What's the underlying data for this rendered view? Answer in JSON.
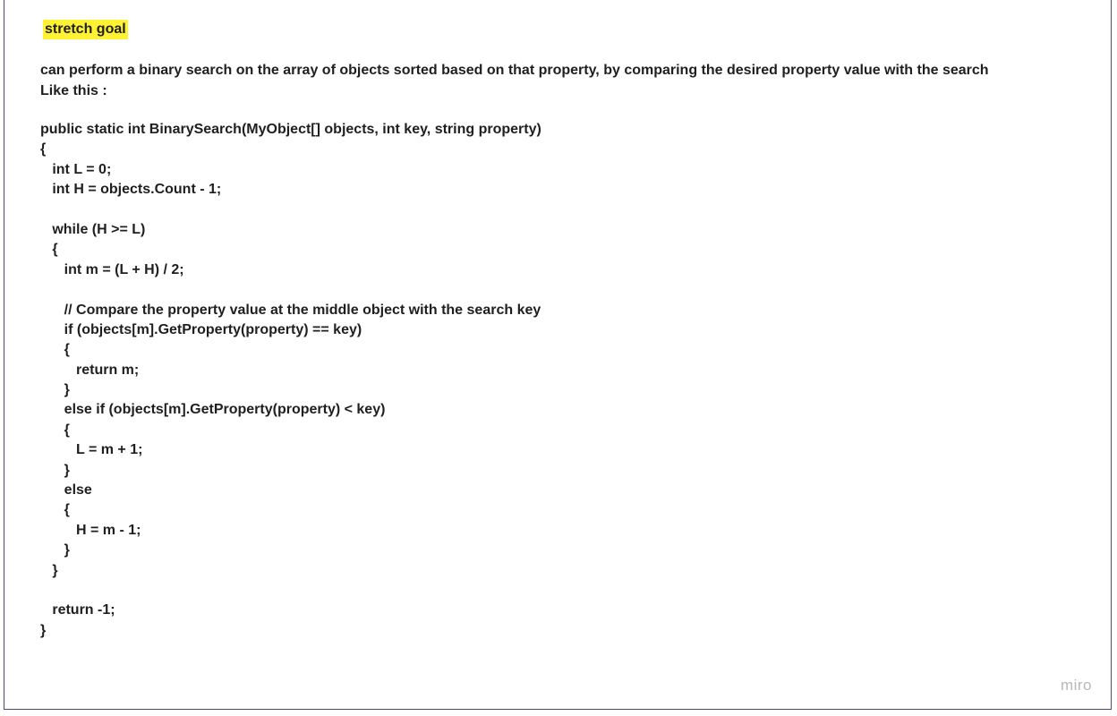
{
  "header": {
    "tag_label": "stretch goal"
  },
  "intro": {
    "line1": " can perform a binary search on the array of objects sorted based on that property, by comparing the desired property value with the search",
    "line2": "Like this :"
  },
  "code_lines": [
    "public static int BinarySearch(MyObject[] objects, int key, string property)",
    "{",
    "   int L = 0;",
    "   int H = objects.Count - 1;",
    "",
    "   while (H >= L)",
    "   {",
    "      int m = (L + H) / 2;",
    "",
    "      // Compare the property value at the middle object with the search key",
    "      if (objects[m].GetProperty(property) == key)",
    "      {",
    "         return m;",
    "      }",
    "      else if (objects[m].GetProperty(property) < key)",
    "      {",
    "         L = m + 1;",
    "      }",
    "      else",
    "      {",
    "         H = m - 1;",
    "      }",
    "   }",
    "",
    "   return -1;",
    "}"
  ],
  "watermark": "miro",
  "colors": {
    "highlight": "#fff233",
    "text": "#1f1f1f",
    "border": "#4a4a7a",
    "watermark": "#b8b8b8"
  }
}
